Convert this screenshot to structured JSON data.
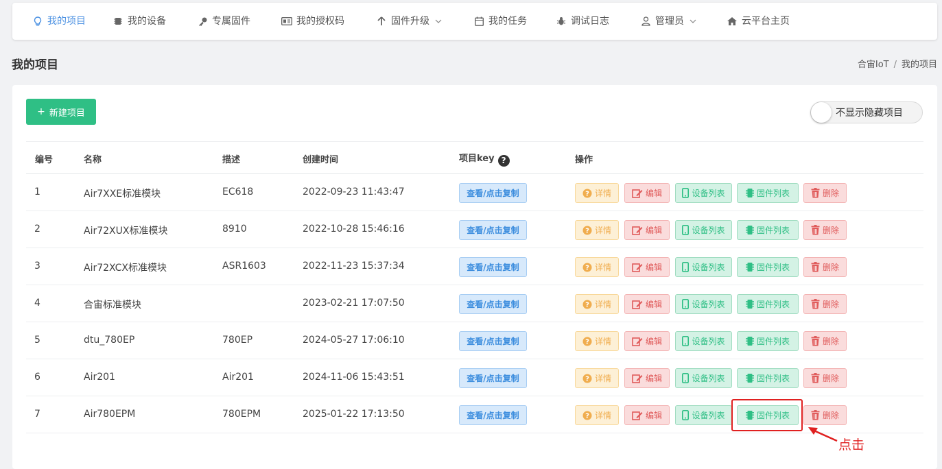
{
  "nav": {
    "items": [
      {
        "label": "我的项目",
        "icon": "lightbulb-icon",
        "active": true
      },
      {
        "label": "我的设备",
        "icon": "chip-icon"
      },
      {
        "label": "专属固件",
        "icon": "key-icon"
      },
      {
        "label": "我的授权码",
        "icon": "id-card-icon"
      },
      {
        "label": "固件升级",
        "icon": "arrow-up-icon",
        "dropdown": true
      },
      {
        "label": "我的任务",
        "icon": "calendar-icon"
      },
      {
        "label": "调试日志",
        "icon": "bug-icon"
      },
      {
        "label": "管理员",
        "icon": "user-icon",
        "dropdown": true
      },
      {
        "label": "云平台主页",
        "icon": "home-icon"
      }
    ]
  },
  "page": {
    "title": "我的项目",
    "breadcrumb": [
      "合宙IoT",
      "我的项目"
    ]
  },
  "toolbar": {
    "new_button": "新建项目",
    "toggle_label": "不显示隐藏项目"
  },
  "table": {
    "headers": {
      "id": "编号",
      "name": "名称",
      "desc": "描述",
      "created": "创建时间",
      "key": "项目key",
      "actions": "操作"
    },
    "key_button": "查看/点击复制",
    "actions": {
      "detail": "详情",
      "edit": "编辑",
      "devices": "设备列表",
      "firmware": "固件列表",
      "delete": "删除"
    },
    "rows": [
      {
        "id": "1",
        "name": "Air7XXE标准模块",
        "desc": "EC618",
        "created": "2022-09-23 11:43:47"
      },
      {
        "id": "2",
        "name": "Air72XUX标准模块",
        "desc": "8910",
        "created": "2022-10-28 15:46:16"
      },
      {
        "id": "3",
        "name": "Air72XCX标准模块",
        "desc": "ASR1603",
        "created": "2022-11-23 15:37:34"
      },
      {
        "id": "4",
        "name": "合宙标准模块",
        "desc": "",
        "created": "2023-02-21 17:07:50"
      },
      {
        "id": "5",
        "name": "dtu_780EP",
        "desc": "780EP",
        "created": "2024-05-27 17:06:10"
      },
      {
        "id": "6",
        "name": "Air201",
        "desc": "Air201",
        "created": "2024-11-06 15:43:51"
      },
      {
        "id": "7",
        "name": "Air780EPM",
        "desc": "780EPM",
        "created": "2025-01-22 17:13:50"
      }
    ]
  },
  "annotation": {
    "label": "点击",
    "color": "#e02020"
  },
  "colors": {
    "accent": "#4a90e2",
    "primary_green": "#2fbf85",
    "danger": "#e05b5b",
    "warning": "#f0ad4e",
    "info": "#3c8dde"
  }
}
